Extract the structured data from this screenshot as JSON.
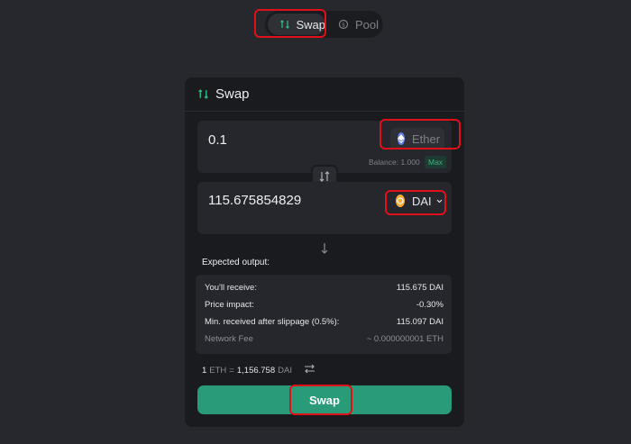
{
  "nav": {
    "swap_label": "Swap",
    "pool_label": "Pool"
  },
  "card": {
    "title": "Swap",
    "from": {
      "amount": "0.1",
      "token": "Ether",
      "balance": "Balance: 1.000",
      "max_label": "Max"
    },
    "to": {
      "amount": "115.675854829",
      "token": "DAI"
    },
    "expected_label": "Expected output:",
    "details": [
      {
        "label": "You'll receive:",
        "value": "115.675 DAI"
      },
      {
        "label": "Price impact:",
        "value": "-0.30%"
      },
      {
        "label": "Min. received after slippage (0.5%):",
        "value": "115.097 DAI"
      },
      {
        "label": "Network Fee",
        "value": "~ 0.000000001 ETH"
      }
    ],
    "rate": {
      "base_amount": "1",
      "base_unit": "ETH",
      "equals": "=",
      "quote_amount": "1,156.758",
      "quote_unit": "DAI"
    },
    "swap_button": "Swap"
  },
  "colors": {
    "accent": "#2a9b79",
    "highlight": "#e0101a",
    "background": "#27282d",
    "card": "#1a1b1f"
  },
  "icons": {
    "nav_swap": "swap-arrows-icon",
    "nav_pool": "pool-coin-icon",
    "ether": "ethereum-icon",
    "dai": "dai-icon",
    "switch": "swap-vertical-icon",
    "rate_toggle": "swap-horizontal-icon"
  }
}
